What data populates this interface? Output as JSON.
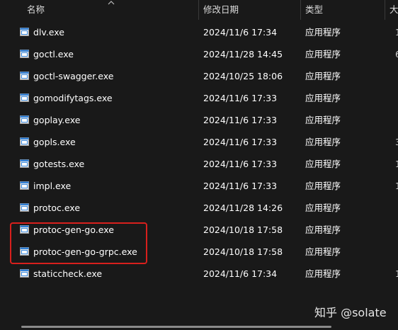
{
  "columns": {
    "name": "名称",
    "date": "修改日期",
    "type": "类型",
    "size": "大"
  },
  "files": [
    {
      "name": "dlv.exe",
      "date": "2024/11/6 17:34",
      "type": "应用程序",
      "size_partial": "1"
    },
    {
      "name": "goctl.exe",
      "date": "2024/11/28 14:45",
      "type": "应用程序",
      "size_partial": "6"
    },
    {
      "name": "goctl-swagger.exe",
      "date": "2024/10/25 18:06",
      "type": "应用程序",
      "size_partial": ""
    },
    {
      "name": "gomodifytags.exe",
      "date": "2024/11/6 17:33",
      "type": "应用程序",
      "size_partial": ""
    },
    {
      "name": "goplay.exe",
      "date": "2024/11/6 17:33",
      "type": "应用程序",
      "size_partial": ""
    },
    {
      "name": "gopls.exe",
      "date": "2024/11/6 17:33",
      "type": "应用程序",
      "size_partial": "3"
    },
    {
      "name": "gotests.exe",
      "date": "2024/11/6 17:33",
      "type": "应用程序",
      "size_partial": "1"
    },
    {
      "name": "impl.exe",
      "date": "2024/11/6 17:33",
      "type": "应用程序",
      "size_partial": "1"
    },
    {
      "name": "protoc.exe",
      "date": "2024/11/28 14:26",
      "type": "应用程序",
      "size_partial": ""
    },
    {
      "name": "protoc-gen-go.exe",
      "date": "2024/10/18 17:58",
      "type": "应用程序",
      "size_partial": ""
    },
    {
      "name": "protoc-gen-go-grpc.exe",
      "date": "2024/10/18 17:58",
      "type": "应用程序",
      "size_partial": ""
    },
    {
      "name": "staticcheck.exe",
      "date": "2024/11/6 17:34",
      "type": "应用程序",
      "size_partial": "1"
    }
  ],
  "watermark": "知乎 @solate",
  "colors": {
    "background": "#191919",
    "text": "#ffffff",
    "highlight": "#d8201d",
    "icon_blue": "#2f7fd6"
  }
}
